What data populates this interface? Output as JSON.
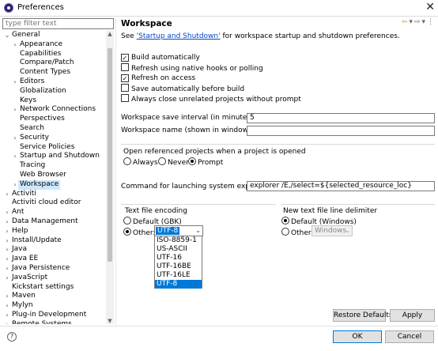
{
  "window": {
    "title": "Preferences",
    "close_glyph": "✕"
  },
  "filter": {
    "placeholder": "type filter text"
  },
  "tree": [
    {
      "label": "General",
      "level": 0,
      "chevron": "⌄"
    },
    {
      "label": "Appearance",
      "level": 1,
      "chevron": "›"
    },
    {
      "label": "Capabilities",
      "level": 1,
      "chevron": ""
    },
    {
      "label": "Compare/Patch",
      "level": 1,
      "chevron": ""
    },
    {
      "label": "Content Types",
      "level": 1,
      "chevron": ""
    },
    {
      "label": "Editors",
      "level": 1,
      "chevron": "›"
    },
    {
      "label": "Globalization",
      "level": 1,
      "chevron": ""
    },
    {
      "label": "Keys",
      "level": 1,
      "chevron": ""
    },
    {
      "label": "Network Connections",
      "level": 1,
      "chevron": "›"
    },
    {
      "label": "Perspectives",
      "level": 1,
      "chevron": ""
    },
    {
      "label": "Search",
      "level": 1,
      "chevron": ""
    },
    {
      "label": "Security",
      "level": 1,
      "chevron": "›"
    },
    {
      "label": "Service Policies",
      "level": 1,
      "chevron": ""
    },
    {
      "label": "Startup and Shutdown",
      "level": 1,
      "chevron": "›"
    },
    {
      "label": "Tracing",
      "level": 1,
      "chevron": ""
    },
    {
      "label": "Web Browser",
      "level": 1,
      "chevron": ""
    },
    {
      "label": "Workspace",
      "level": 1,
      "chevron": "›",
      "selected": true
    },
    {
      "label": "Activiti",
      "level": 0,
      "chevron": "›"
    },
    {
      "label": "Activiti cloud editor",
      "level": 0,
      "chevron": ""
    },
    {
      "label": "Ant",
      "level": 0,
      "chevron": "›"
    },
    {
      "label": "Data Management",
      "level": 0,
      "chevron": "›"
    },
    {
      "label": "Help",
      "level": 0,
      "chevron": "›"
    },
    {
      "label": "Install/Update",
      "level": 0,
      "chevron": "›"
    },
    {
      "label": "Java",
      "level": 0,
      "chevron": "›"
    },
    {
      "label": "Java EE",
      "level": 0,
      "chevron": "›"
    },
    {
      "label": "Java Persistence",
      "level": 0,
      "chevron": "›"
    },
    {
      "label": "JavaScript",
      "level": 0,
      "chevron": "›"
    },
    {
      "label": "Kickstart settings",
      "level": 0,
      "chevron": ""
    },
    {
      "label": "Maven",
      "level": 0,
      "chevron": "›"
    },
    {
      "label": "Mylyn",
      "level": 0,
      "chevron": "›"
    },
    {
      "label": "Plug-in Development",
      "level": 0,
      "chevron": "›"
    },
    {
      "label": "Remote Systems",
      "level": 0,
      "chevron": "›"
    }
  ],
  "page": {
    "title": "Workspace",
    "nav": {
      "back": "⇦",
      "back_menu": "▾",
      "forward": "⇨",
      "forward_menu": "▾",
      "menu": "⋮"
    },
    "intro": {
      "before": "See ",
      "link": "'Startup and Shutdown'",
      "after": " for workspace startup and shutdown preferences."
    },
    "checkboxes": [
      {
        "label": "Build automatically",
        "checked": true
      },
      {
        "label": "Refresh using native hooks or polling",
        "checked": false
      },
      {
        "label": "Refresh on access",
        "checked": true
      },
      {
        "label": "Save automatically before build",
        "checked": false
      },
      {
        "label": "Always close unrelated projects without prompt",
        "checked": false
      }
    ],
    "save_interval": {
      "label": "Workspace save interval (in minutes):",
      "value": "5"
    },
    "workspace_name": {
      "label": "Workspace name (shown in window title):",
      "value": ""
    },
    "open_projects": {
      "title": "Open referenced projects when a project is opened",
      "options": [
        {
          "label": "Always",
          "selected": false
        },
        {
          "label": "Never",
          "selected": false
        },
        {
          "label": "Prompt",
          "selected": true
        }
      ]
    },
    "explorer_command": {
      "label": "Command for launching system explorer:",
      "value": "explorer /E,/select=${selected_resource_loc}"
    },
    "encoding": {
      "title": "Text file encoding",
      "default_label": "Default (GBK)",
      "other_label": "Other:",
      "value": "UTF-8",
      "dropdown_options": [
        "ISO-8859-1",
        "US-ASCII",
        "UTF-16",
        "UTF-16BE",
        "UTF-16LE",
        "UTF-8"
      ],
      "dropdown_selected": "UTF-8"
    },
    "line_delimiter": {
      "title": "New text file line delimiter",
      "default_label": "Default (Windows)",
      "other_label": "Other:",
      "value": "Windows"
    },
    "buttons": {
      "restore": "Restore Defaults",
      "apply": "Apply"
    }
  },
  "footer": {
    "help": "?",
    "ok": "OK",
    "cancel": "Cancel"
  },
  "chevrons": {
    "expanded": "⌄",
    "collapsed": "›",
    "dropdown": "⌄",
    "scroll_up": "▲",
    "scroll_down": "▼"
  },
  "colors": {
    "selection": "#cce8ff",
    "highlight": "#0078d7",
    "link": "#0645c8"
  }
}
